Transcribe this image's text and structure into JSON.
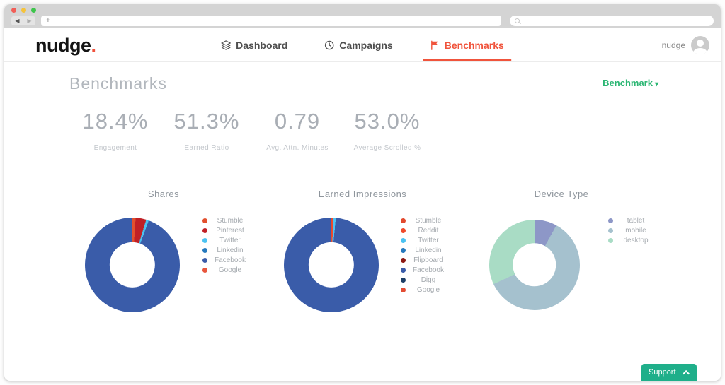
{
  "browser": {
    "back_glyph": "◀",
    "forward_glyph": "▶",
    "address_value": "",
    "search_value": ""
  },
  "nav": {
    "logo_text": "nudge",
    "logo_dot": ".",
    "items": [
      {
        "label": "Dashboard",
        "icon": "layers-icon",
        "active": false
      },
      {
        "label": "Campaigns",
        "icon": "clock-icon",
        "active": false
      },
      {
        "label": "Benchmarks",
        "icon": "flag-icon",
        "active": true
      }
    ],
    "user_name": "nudge"
  },
  "page": {
    "title": "Benchmarks",
    "filter_label": "Benchmark",
    "filter_caret": "▾"
  },
  "stats": [
    {
      "value": "18.4%",
      "label": "Engagement"
    },
    {
      "value": "51.3%",
      "label": "Earned Ratio"
    },
    {
      "value": "0.79",
      "label": "Avg. Attn. Minutes"
    },
    {
      "value": "53.0%",
      "label": "Average Scrolled %"
    }
  ],
  "chart_data": [
    {
      "type": "pie",
      "donut": true,
      "title": "Shares",
      "legend_position": "right",
      "series": [
        {
          "name": "Stumble",
          "value": 1.1,
          "color": "#e2502e"
        },
        {
          "name": "Pinterest",
          "value": 3.6,
          "color": "#c02026"
        },
        {
          "name": "Twitter",
          "value": 0.9,
          "color": "#4bc2f1"
        },
        {
          "name": "Linkedin",
          "value": 0.0,
          "color": "#2579bd"
        },
        {
          "name": "Facebook",
          "value": 94.4,
          "color": "#3a5ca9"
        },
        {
          "name": "Google",
          "value": 0.0,
          "color": "#e8563d"
        }
      ]
    },
    {
      "type": "pie",
      "donut": true,
      "title": "Earned Impressions",
      "legend_position": "right",
      "series": [
        {
          "name": "Stumble",
          "value": 0.3,
          "color": "#e2492e"
        },
        {
          "name": "Reddit",
          "value": 0.4,
          "color": "#f04a2b"
        },
        {
          "name": "Twitter",
          "value": 0.8,
          "color": "#4bc2f1"
        },
        {
          "name": "Linkedin",
          "value": 0.0,
          "color": "#2579bd"
        },
        {
          "name": "Flipboard",
          "value": 0.0,
          "color": "#8e1a14"
        },
        {
          "name": "Facebook",
          "value": 98.5,
          "color": "#3a5ca9"
        },
        {
          "name": "Digg",
          "value": 0.0,
          "color": "#1c3f66"
        },
        {
          "name": "Google",
          "value": 0.0,
          "color": "#e34c33"
        }
      ]
    },
    {
      "type": "pie",
      "donut": true,
      "title": "Device Type",
      "legend_position": "right",
      "series": [
        {
          "name": "tablet",
          "value": 8,
          "color": "#8d97c7"
        },
        {
          "name": "mobile",
          "value": 60,
          "color": "#a5c1ce"
        },
        {
          "name": "desktop",
          "value": 32,
          "color": "#a9dcc5"
        }
      ]
    }
  ],
  "support": {
    "label": "Support"
  },
  "colors": {
    "accent_orange": "#f0543c",
    "accent_green": "#2bb673",
    "support_green": "#1faf8a",
    "stat_text": "#a9aeb5"
  }
}
